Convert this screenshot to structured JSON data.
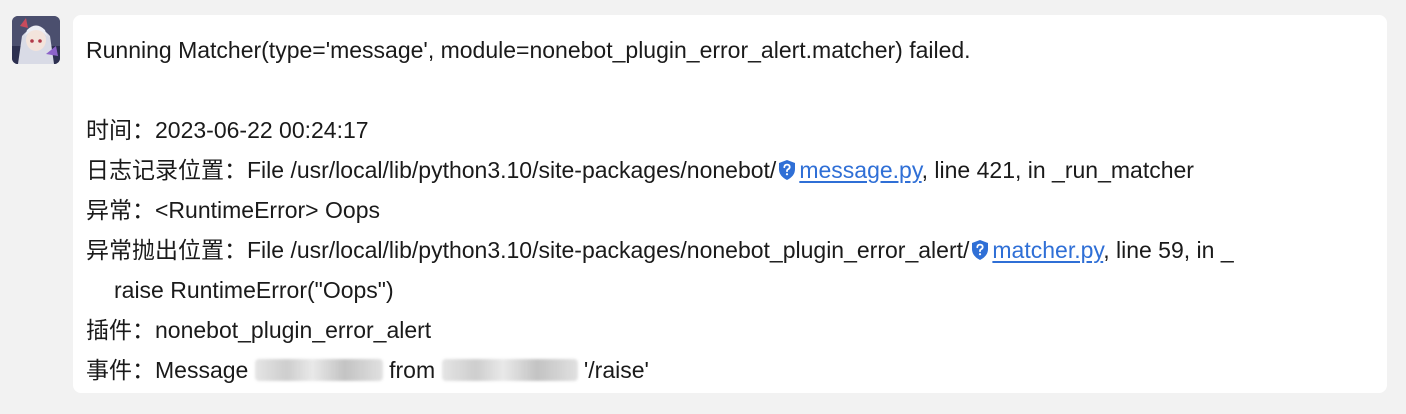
{
  "avatar_icon": "anime-character-avatar",
  "message": {
    "title": "Running Matcher(type='message', module=nonebot_plugin_error_alert.matcher) failed.",
    "time_label": "时间：",
    "time_value": "2023-06-22 00:24:17",
    "log_label": "日志记录位置：",
    "log_prefix": "File /usr/local/lib/python3.10/site-packages/nonebot/",
    "log_file": "message.py",
    "log_suffix": ", line 421, in _run_matcher",
    "exception_label": "异常：",
    "exception_value": "<RuntimeError> Oops",
    "raise_label": "异常抛出位置：",
    "raise_prefix": "File /usr/local/lib/python3.10/site-packages/nonebot_plugin_error_alert/",
    "raise_file": "matcher.py",
    "raise_suffix": ", line 59, in _",
    "raise_code": "raise RuntimeError(\"Oops\")",
    "plugin_label": "插件：",
    "plugin_value": "nonebot_plugin_error_alert",
    "event_label": "事件：",
    "event_message": "Message",
    "event_from": "from",
    "event_tail": "'/raise'"
  },
  "icons": {
    "link_shield": "shield-question-icon"
  },
  "colors": {
    "link": "#2f6fd6",
    "shield": "#2f6fd6",
    "background": "#f2f2f2",
    "bubble": "#ffffff"
  }
}
